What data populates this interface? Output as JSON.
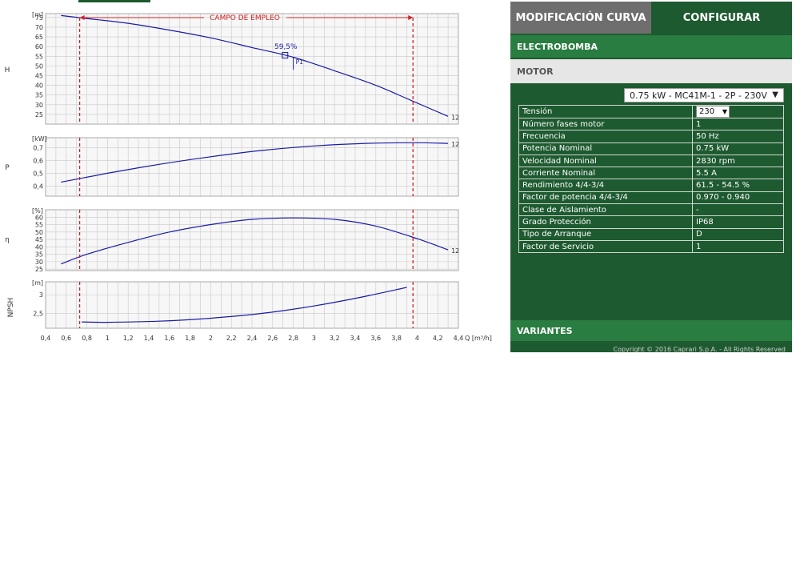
{
  "chart_data": [
    {
      "type": "line",
      "ylabel": "H",
      "unit": "[m]",
      "ylim": [
        20,
        77
      ],
      "yticks": [
        25,
        30,
        35,
        40,
        45,
        50,
        55,
        60,
        65,
        70,
        75
      ],
      "xlim": [
        0.4,
        4.4
      ],
      "series": [
        {
          "name": "12",
          "x": [
            0.55,
            0.8,
            1.2,
            1.6,
            2.0,
            2.4,
            2.8,
            3.2,
            3.6,
            3.95,
            4.3
          ],
          "y": [
            76,
            74.5,
            72,
            68.5,
            64.5,
            59.5,
            54.5,
            47.5,
            40,
            32,
            24
          ]
        }
      ],
      "annotations": {
        "band_label": "CAMPO DE EMPLEO",
        "efficiency_label": "59,5%",
        "point_label": "P1"
      }
    },
    {
      "type": "line",
      "ylabel": "P",
      "unit": "[kW]",
      "ylim": [
        0.32,
        0.78
      ],
      "yticks": [
        0.4,
        0.5,
        0.6,
        0.7
      ],
      "ytick_labels": [
        "0,4",
        "0,5",
        "0,6",
        "0,7"
      ],
      "xlim": [
        0.4,
        4.4
      ],
      "series": [
        {
          "name": "12",
          "x": [
            0.55,
            1.0,
            1.5,
            2.0,
            2.5,
            3.0,
            3.5,
            4.0,
            4.3
          ],
          "y": [
            0.43,
            0.5,
            0.57,
            0.63,
            0.68,
            0.715,
            0.735,
            0.74,
            0.735
          ]
        }
      ]
    },
    {
      "type": "line",
      "ylabel": "η",
      "unit": "[%]",
      "ylim": [
        24,
        65
      ],
      "yticks": [
        25,
        30,
        35,
        40,
        45,
        50,
        55,
        60
      ],
      "xlim": [
        0.4,
        4.4
      ],
      "series": [
        {
          "name": "12",
          "x": [
            0.55,
            0.8,
            1.2,
            1.6,
            2.0,
            2.4,
            2.8,
            3.2,
            3.6,
            4.0,
            4.3
          ],
          "y": [
            28.5,
            35,
            43,
            50,
            55,
            58.5,
            59.5,
            58.5,
            54,
            45.5,
            38
          ]
        }
      ]
    },
    {
      "type": "line",
      "ylabel": "NPSH",
      "unit": "[m]",
      "ylim": [
        2.1,
        3.35
      ],
      "yticks": [
        2.5,
        3
      ],
      "ytick_labels": [
        "2,5",
        "3"
      ],
      "xlim": [
        0.4,
        4.4
      ],
      "xlabel": "Q [m³/h]",
      "xticks": [
        "0,4",
        "0,6",
        "0,8",
        "1",
        "1,2",
        "1,4",
        "1,6",
        "1,8",
        "2",
        "2,2",
        "2,4",
        "2,6",
        "2,8",
        "3",
        "3,2",
        "3,4",
        "3,6",
        "3,8",
        "4",
        "4,2",
        "4,4"
      ],
      "series": [
        {
          "name": "",
          "x": [
            0.75,
            1.0,
            1.5,
            2.0,
            2.5,
            3.0,
            3.5,
            3.9
          ],
          "y": [
            2.27,
            2.26,
            2.29,
            2.37,
            2.5,
            2.7,
            2.96,
            3.2
          ]
        }
      ]
    }
  ],
  "panel": {
    "tabs": [
      "MODIFICACIÓN CURVA",
      "CONFIGURAR"
    ],
    "sections": {
      "electrobomba": "ELECTROBOMBA",
      "motor": "MOTOR",
      "variantes": "VARIANTES"
    },
    "motor_select": "0.75 kW - MC41M-1 - 2P - 230V",
    "table": [
      {
        "label": "Tensión",
        "value": "230"
      },
      {
        "label": "Número fases motor",
        "value": "1"
      },
      {
        "label": "Frecuencia",
        "value": "50  Hz"
      },
      {
        "label": "Potencia Nominal",
        "value": "0.75  kW"
      },
      {
        "label": "Velocidad Nominal",
        "value": "2830  rpm"
      },
      {
        "label": "Corriente Nominal",
        "value": "5.5  A"
      },
      {
        "label": "Rendimiento 4/4-3/4",
        "value": "61.5 - 54.5  %"
      },
      {
        "label": "Factor de potencia 4/4-3/4",
        "value": "0.970 - 0.940"
      },
      {
        "label": "Clase de Aislamiento",
        "value": "-"
      },
      {
        "label": "Grado Protección",
        "value": "IP68"
      },
      {
        "label": "Tipo de Arranque",
        "value": "D"
      },
      {
        "label": "Factor de Servicio",
        "value": "1"
      }
    ],
    "copyright": "Copyright © 2016 Caprari S.p.A. - All Rights Reserved"
  },
  "colors": {
    "curve": "#1a1aa8",
    "band": "#d42020",
    "grid": "#c8c8c8",
    "panel_green": "#1e5a30",
    "header_green": "#2a7d41",
    "tab_grey": "#6e6e6e"
  }
}
